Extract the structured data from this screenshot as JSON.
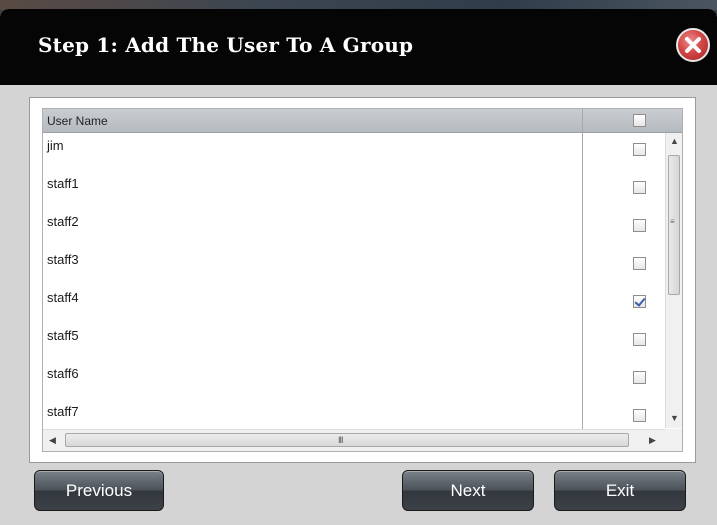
{
  "dialog": {
    "title": "Step 1: Add The User To A Group",
    "close_icon": "close-icon"
  },
  "table": {
    "header": "User Name",
    "select_all_checked": false,
    "rows": [
      {
        "name": "jim",
        "checked": false
      },
      {
        "name": "staff1",
        "checked": false
      },
      {
        "name": "staff2",
        "checked": false
      },
      {
        "name": "staff3",
        "checked": false
      },
      {
        "name": "staff4",
        "checked": true
      },
      {
        "name": "staff5",
        "checked": false
      },
      {
        "name": "staff6",
        "checked": false
      },
      {
        "name": "staff7",
        "checked": false
      }
    ],
    "hscroll_grip": "III"
  },
  "buttons": {
    "previous": "Previous",
    "next": "Next",
    "exit": "Exit"
  },
  "colors": {
    "title_bar": "#050505",
    "dialog_bg": "#d4d4d4",
    "close_red": "#d24848",
    "check_blue": "#3a5fb0"
  }
}
